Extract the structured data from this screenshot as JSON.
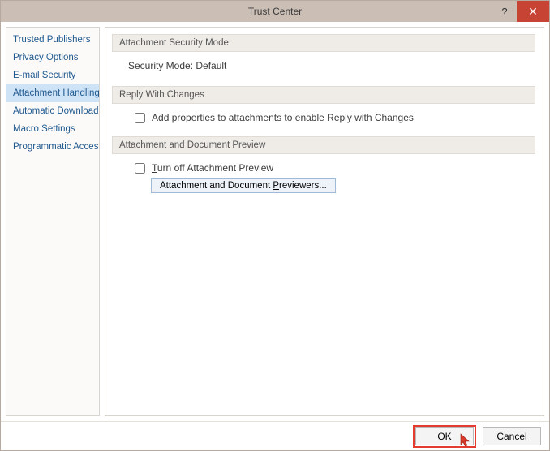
{
  "titlebar": {
    "title": "Trust Center"
  },
  "sidebar": {
    "items": [
      {
        "label": "Trusted Publishers"
      },
      {
        "label": "Privacy Options"
      },
      {
        "label": "E-mail Security"
      },
      {
        "label": "Attachment Handling"
      },
      {
        "label": "Automatic Download"
      },
      {
        "label": "Macro Settings"
      },
      {
        "label": "Programmatic Access"
      }
    ]
  },
  "main": {
    "sec1": {
      "head": "Attachment Security Mode",
      "line": "Security Mode: Default"
    },
    "sec2": {
      "head": "Reply With Changes",
      "chk_pre": "",
      "chk_u": "A",
      "chk_post": "dd properties to attachments to enable Reply with Changes"
    },
    "sec3": {
      "head": "Attachment and Document Preview",
      "chk_u": "T",
      "chk_post": "urn off Attachment Preview",
      "btn_pre": "Attachment and Document ",
      "btn_u": "P",
      "btn_post": "reviewers..."
    }
  },
  "footer": {
    "ok": "OK",
    "cancel": "Cancel"
  }
}
